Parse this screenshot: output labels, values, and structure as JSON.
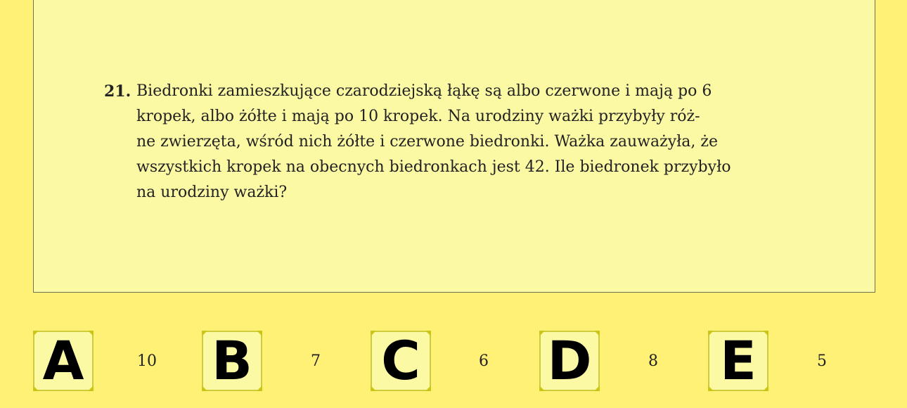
{
  "question": {
    "number": "21.",
    "lines": [
      "Biedronki zamieszkujące czarodziejską łąkę są albo czerwone i mają po 6",
      "kropek, albo żółte i mają po 10 kropek. Na urodziny ważki przybyły róż-",
      "ne zwierzęta, wśród nich żółte i czerwone biedronki. Ważka zauważyła, że",
      "wszystkich kropek na obecnych biedronkach jest 42. Ile biedronek przybyło",
      "na urodziny ważki?"
    ]
  },
  "answers": [
    {
      "letter": "A",
      "value": "10"
    },
    {
      "letter": "B",
      "value": "7"
    },
    {
      "letter": "C",
      "value": "6"
    },
    {
      "letter": "D",
      "value": "8"
    },
    {
      "letter": "E",
      "value": "5"
    }
  ],
  "colors": {
    "background": "#fef176",
    "card": "#fcf9a5",
    "tile_border": "#cfcc3c"
  }
}
